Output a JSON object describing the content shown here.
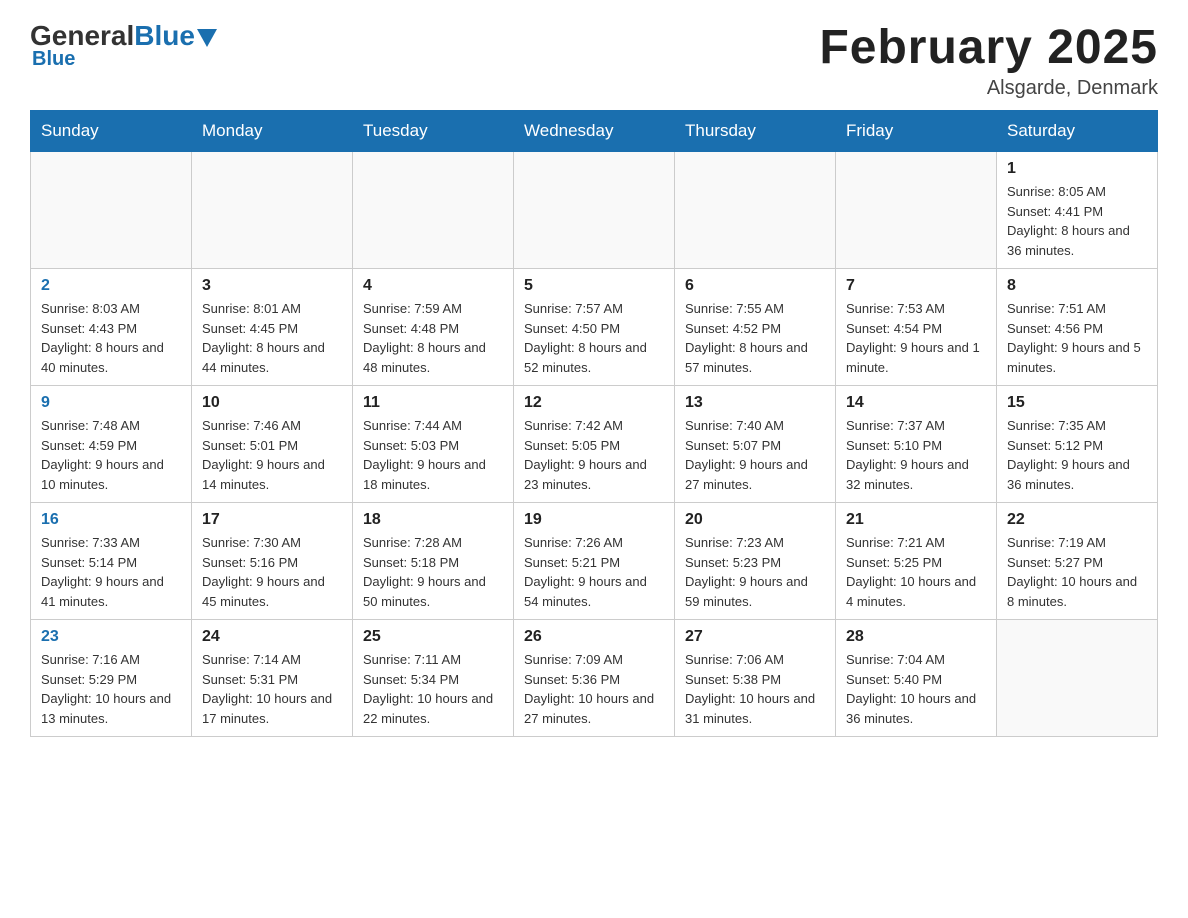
{
  "header": {
    "logo": {
      "general": "General",
      "blue": "Blue"
    },
    "title": "February 2025",
    "location": "Alsgarde, Denmark"
  },
  "calendar": {
    "weekdays": [
      "Sunday",
      "Monday",
      "Tuesday",
      "Wednesday",
      "Thursday",
      "Friday",
      "Saturday"
    ],
    "rows": [
      [
        {
          "day": "",
          "info": ""
        },
        {
          "day": "",
          "info": ""
        },
        {
          "day": "",
          "info": ""
        },
        {
          "day": "",
          "info": ""
        },
        {
          "day": "",
          "info": ""
        },
        {
          "day": "",
          "info": ""
        },
        {
          "day": "1",
          "info": "Sunrise: 8:05 AM\nSunset: 4:41 PM\nDaylight: 8 hours and 36 minutes."
        }
      ],
      [
        {
          "day": "2",
          "info": "Sunrise: 8:03 AM\nSunset: 4:43 PM\nDaylight: 8 hours and 40 minutes."
        },
        {
          "day": "3",
          "info": "Sunrise: 8:01 AM\nSunset: 4:45 PM\nDaylight: 8 hours and 44 minutes."
        },
        {
          "day": "4",
          "info": "Sunrise: 7:59 AM\nSunset: 4:48 PM\nDaylight: 8 hours and 48 minutes."
        },
        {
          "day": "5",
          "info": "Sunrise: 7:57 AM\nSunset: 4:50 PM\nDaylight: 8 hours and 52 minutes."
        },
        {
          "day": "6",
          "info": "Sunrise: 7:55 AM\nSunset: 4:52 PM\nDaylight: 8 hours and 57 minutes."
        },
        {
          "day": "7",
          "info": "Sunrise: 7:53 AM\nSunset: 4:54 PM\nDaylight: 9 hours and 1 minute."
        },
        {
          "day": "8",
          "info": "Sunrise: 7:51 AM\nSunset: 4:56 PM\nDaylight: 9 hours and 5 minutes."
        }
      ],
      [
        {
          "day": "9",
          "info": "Sunrise: 7:48 AM\nSunset: 4:59 PM\nDaylight: 9 hours and 10 minutes."
        },
        {
          "day": "10",
          "info": "Sunrise: 7:46 AM\nSunset: 5:01 PM\nDaylight: 9 hours and 14 minutes."
        },
        {
          "day": "11",
          "info": "Sunrise: 7:44 AM\nSunset: 5:03 PM\nDaylight: 9 hours and 18 minutes."
        },
        {
          "day": "12",
          "info": "Sunrise: 7:42 AM\nSunset: 5:05 PM\nDaylight: 9 hours and 23 minutes."
        },
        {
          "day": "13",
          "info": "Sunrise: 7:40 AM\nSunset: 5:07 PM\nDaylight: 9 hours and 27 minutes."
        },
        {
          "day": "14",
          "info": "Sunrise: 7:37 AM\nSunset: 5:10 PM\nDaylight: 9 hours and 32 minutes."
        },
        {
          "day": "15",
          "info": "Sunrise: 7:35 AM\nSunset: 5:12 PM\nDaylight: 9 hours and 36 minutes."
        }
      ],
      [
        {
          "day": "16",
          "info": "Sunrise: 7:33 AM\nSunset: 5:14 PM\nDaylight: 9 hours and 41 minutes."
        },
        {
          "day": "17",
          "info": "Sunrise: 7:30 AM\nSunset: 5:16 PM\nDaylight: 9 hours and 45 minutes."
        },
        {
          "day": "18",
          "info": "Sunrise: 7:28 AM\nSunset: 5:18 PM\nDaylight: 9 hours and 50 minutes."
        },
        {
          "day": "19",
          "info": "Sunrise: 7:26 AM\nSunset: 5:21 PM\nDaylight: 9 hours and 54 minutes."
        },
        {
          "day": "20",
          "info": "Sunrise: 7:23 AM\nSunset: 5:23 PM\nDaylight: 9 hours and 59 minutes."
        },
        {
          "day": "21",
          "info": "Sunrise: 7:21 AM\nSunset: 5:25 PM\nDaylight: 10 hours and 4 minutes."
        },
        {
          "day": "22",
          "info": "Sunrise: 7:19 AM\nSunset: 5:27 PM\nDaylight: 10 hours and 8 minutes."
        }
      ],
      [
        {
          "day": "23",
          "info": "Sunrise: 7:16 AM\nSunset: 5:29 PM\nDaylight: 10 hours and 13 minutes."
        },
        {
          "day": "24",
          "info": "Sunrise: 7:14 AM\nSunset: 5:31 PM\nDaylight: 10 hours and 17 minutes."
        },
        {
          "day": "25",
          "info": "Sunrise: 7:11 AM\nSunset: 5:34 PM\nDaylight: 10 hours and 22 minutes."
        },
        {
          "day": "26",
          "info": "Sunrise: 7:09 AM\nSunset: 5:36 PM\nDaylight: 10 hours and 27 minutes."
        },
        {
          "day": "27",
          "info": "Sunrise: 7:06 AM\nSunset: 5:38 PM\nDaylight: 10 hours and 31 minutes."
        },
        {
          "day": "28",
          "info": "Sunrise: 7:04 AM\nSunset: 5:40 PM\nDaylight: 10 hours and 36 minutes."
        },
        {
          "day": "",
          "info": ""
        }
      ]
    ]
  }
}
